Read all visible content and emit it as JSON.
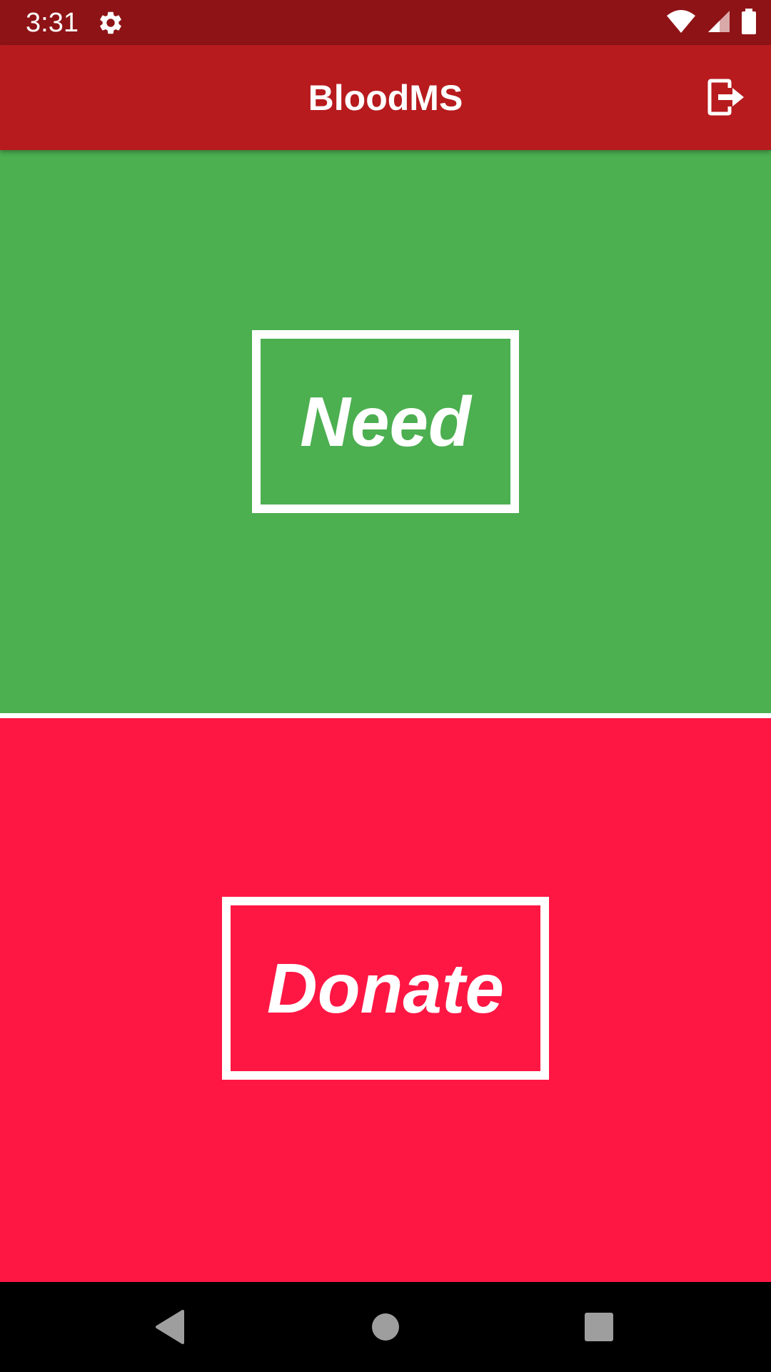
{
  "status_bar": {
    "time": "3:31",
    "icons": [
      "settings-icon",
      "wifi-icon",
      "cell-signal-icon",
      "battery-icon"
    ]
  },
  "app_bar": {
    "title": "BloodMS",
    "action_icon": "logout-icon"
  },
  "panels": {
    "need": {
      "label": "Need",
      "color": "#4CAF50"
    },
    "donate": {
      "label": "Donate",
      "color": "#FF1744"
    }
  },
  "nav_bar": {
    "icons": [
      "back-icon",
      "home-icon",
      "recents-icon"
    ]
  },
  "colors": {
    "status_bar": "#8E1316",
    "app_bar": "#B71B1E",
    "divider": "#FFFFFF",
    "nav_bar": "#000000"
  }
}
